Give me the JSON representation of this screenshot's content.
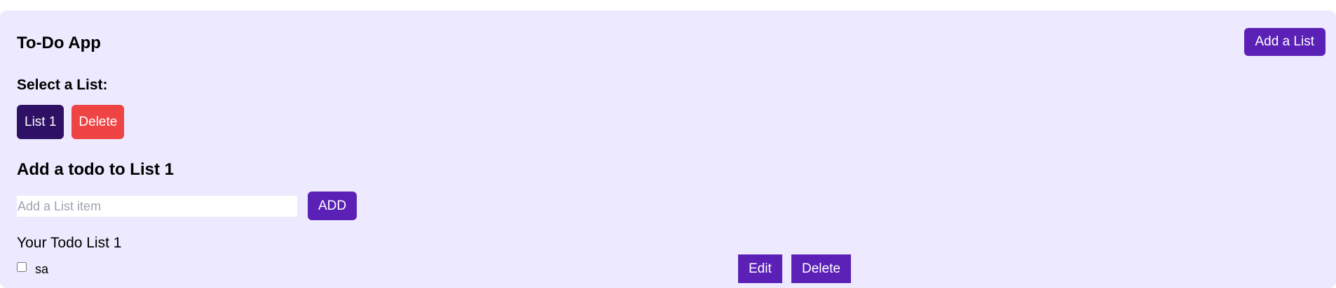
{
  "app": {
    "title": "To-Do App",
    "add_list_label": "Add a List"
  },
  "lists": {
    "heading": "Select a List:",
    "items": [
      {
        "label": "List 1",
        "selected": true
      }
    ],
    "delete_label": "Delete"
  },
  "todo_form": {
    "heading": "Add a todo to List 1",
    "input_placeholder": "Add a List item",
    "input_value": "",
    "add_label": "ADD"
  },
  "todo_list": {
    "title": "Your Todo List 1",
    "items": [
      {
        "text": "sa",
        "checked": false,
        "edit_label": "Edit",
        "delete_label": "Delete"
      }
    ]
  },
  "colors": {
    "panel_background": "#ede9fe",
    "primary_button": "#5b21b6",
    "selected_list_button": "#2e1065",
    "danger_button": "#ef4444",
    "placeholder_text": "#9ca3af"
  }
}
